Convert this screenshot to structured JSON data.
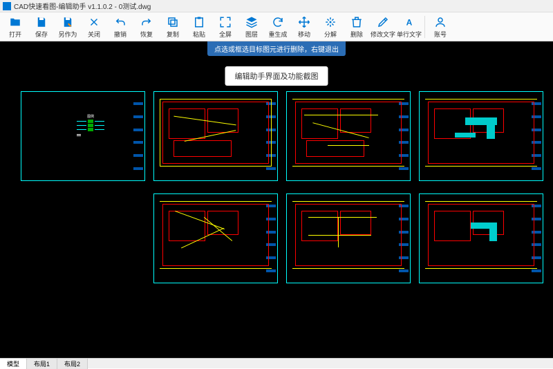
{
  "window": {
    "title": "CAD快速看图-编辑助手 v1.1.0.2 - 0测试.dwg"
  },
  "toolbar": {
    "items": [
      {
        "id": "open",
        "label": "打开",
        "icon": "folder"
      },
      {
        "id": "save",
        "label": "保存",
        "icon": "save"
      },
      {
        "id": "saveas",
        "label": "另作为",
        "icon": "saveas"
      },
      {
        "id": "close",
        "label": "关闭",
        "icon": "close"
      },
      {
        "id": "undo",
        "label": "撤销",
        "icon": "undo"
      },
      {
        "id": "redo",
        "label": "恢复",
        "icon": "redo"
      },
      {
        "id": "copy",
        "label": "复制",
        "icon": "copy"
      },
      {
        "id": "paste",
        "label": "粘贴",
        "icon": "paste"
      },
      {
        "id": "fit",
        "label": "全屏",
        "icon": "fit"
      },
      {
        "id": "layer",
        "label": "图层",
        "icon": "layer"
      },
      {
        "id": "regen",
        "label": "重生成",
        "icon": "regen"
      },
      {
        "id": "move",
        "label": "移动",
        "icon": "move"
      },
      {
        "id": "explode",
        "label": "分解",
        "icon": "explode"
      },
      {
        "id": "delete",
        "label": "删除",
        "icon": "delete"
      },
      {
        "id": "edittext",
        "label": "修改文字",
        "icon": "edittext"
      },
      {
        "id": "singletext",
        "label": "单行文字",
        "icon": "text"
      },
      {
        "id": "account",
        "label": "账号",
        "icon": "user"
      }
    ]
  },
  "canvas": {
    "hint": "点选或框选目标图元进行删除，右键退出",
    "centerButton": "编辑助手界面及功能截图"
  },
  "tabs": {
    "items": [
      {
        "id": "model",
        "label": "模型",
        "active": true
      },
      {
        "id": "layout1",
        "label": "布局1",
        "active": false
      },
      {
        "id": "layout2",
        "label": "布局2",
        "active": false
      }
    ]
  },
  "colors": {
    "accent": "#0078d4",
    "canvasBg": "#000000",
    "thumbBorder": "#00ffff",
    "planLine": "#ff0000",
    "dimLine": "#ffff00",
    "hvac": "#00cccc"
  }
}
